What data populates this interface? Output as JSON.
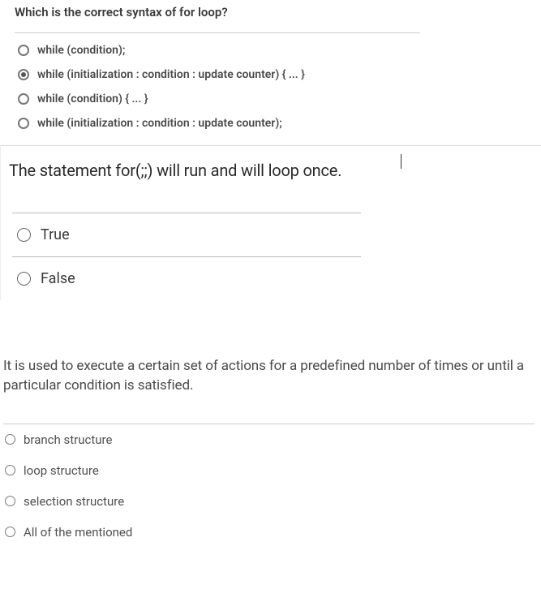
{
  "q1": {
    "title": "Which is the correct syntax of for loop?",
    "options": [
      {
        "label": "while (condition);",
        "selected": false
      },
      {
        "label": "while (initialization : condition : update counter) { ... }",
        "selected": true
      },
      {
        "label": "while (condition) { ... }",
        "selected": false
      },
      {
        "label": "while (initialization : condition : update counter);",
        "selected": false
      }
    ]
  },
  "q2": {
    "title": "The statement for(;;) will run and will loop once.",
    "options": [
      {
        "label": "True"
      },
      {
        "label": "False"
      }
    ]
  },
  "q3": {
    "title": "It is used to execute a certain set of actions for a predefined number of times or until a particular condition is satisfied.",
    "options": [
      {
        "label": "branch structure"
      },
      {
        "label": "loop structure"
      },
      {
        "label": "selection structure"
      },
      {
        "label": "All of the mentioned"
      }
    ]
  }
}
